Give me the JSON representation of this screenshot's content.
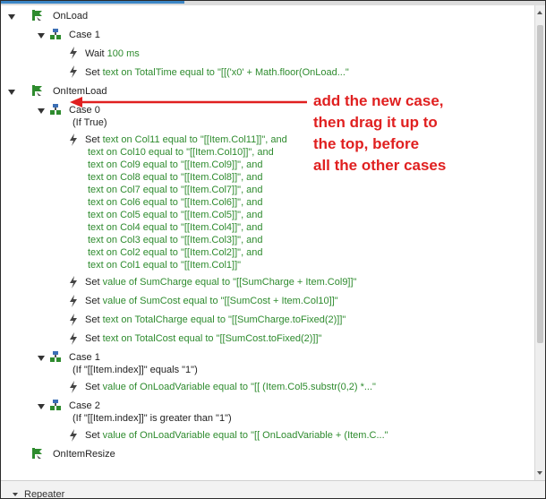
{
  "colors": {
    "accent": "#3c86c6",
    "annotation": "#e02020",
    "value_green": "#2e8b2e",
    "event_icon": "#2e8b2e",
    "case_icon": "#3c6fb5"
  },
  "events": [
    {
      "name": "OnLoad"
    },
    {
      "name": "OnItemLoad"
    },
    {
      "name": "OnItemResize"
    }
  ],
  "onload": {
    "case1": {
      "label": "Case 1"
    },
    "wait": {
      "prefix": "Wait ",
      "value": "100 ms"
    },
    "set1": {
      "prefix": "Set ",
      "value": "text on TotalTime equal to \"[[('x0' + Math.floor(OnLoad...\""
    }
  },
  "onitemload": {
    "case0": {
      "label": "Case 0",
      "condition": "(If True)",
      "set_prefix": "Set ",
      "set_lines": [
        "text on Col11 equal to \"[[Item.Col11]]\", and",
        "text on Col10 equal to \"[[Item.Col10]]\", and",
        "text on Col9 equal to \"[[Item.Col9]]\", and",
        "text on Col8 equal to \"[[Item.Col8]]\", and",
        "text on Col7 equal to \"[[Item.Col7]]\", and",
        "text on Col6 equal to \"[[Item.Col6]]\", and",
        "text on Col5 equal to \"[[Item.Col5]]\", and",
        "text on Col4 equal to \"[[Item.Col4]]\", and",
        "text on Col3 equal to \"[[Item.Col3]]\", and",
        "text on Col2 equal to \"[[Item.Col2]]\", and",
        "text on Col1 equal to \"[[Item.Col1]]\""
      ],
      "actions": [
        {
          "prefix": "Set ",
          "value": "value of SumCharge equal to \"[[SumCharge + Item.Col9]]\""
        },
        {
          "prefix": "Set ",
          "value": "value of SumCost equal to \"[[SumCost + Item.Col10]]\""
        },
        {
          "prefix": "Set ",
          "value": "text on TotalCharge equal to \"[[SumCharge.toFixed(2)]]\""
        },
        {
          "prefix": "Set ",
          "value": "text on TotalCost equal to \"[[SumCost.toFixed(2)]]\""
        }
      ]
    },
    "case1": {
      "label": "Case 1",
      "condition": "(If \"[[Item.index]]\" equals \"1\")",
      "action": {
        "prefix": "Set ",
        "value": "value of OnLoadVariable equal to \"[[ (Item.Col5.substr(0,2) *...\""
      }
    },
    "case2": {
      "label": "Case 2",
      "condition": "(If \"[[Item.index]]\" is greater than \"1\")",
      "action": {
        "prefix": "Set ",
        "value": "value of OnLoadVariable equal to \"[[ OnLoadVariable + (Item.C...\""
      }
    }
  },
  "annotation": {
    "lines": [
      "add the new case,",
      "then drag it up to",
      "the top, before",
      "all the other cases"
    ]
  },
  "bottom": {
    "label": "Repeater"
  }
}
